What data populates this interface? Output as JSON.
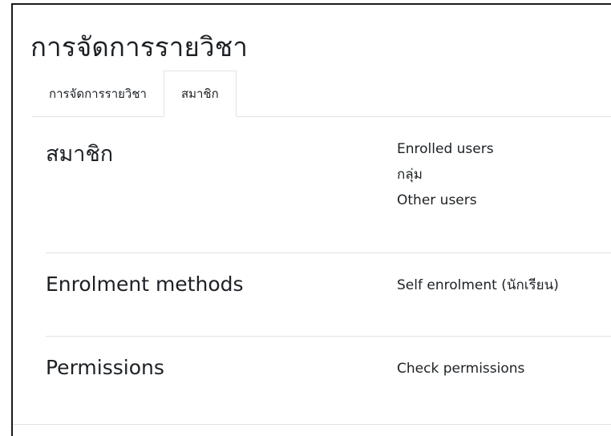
{
  "page": {
    "title": "การจัดการรายวิชา"
  },
  "tabs": [
    {
      "label": "การจัดการรายวิชา",
      "active": false
    },
    {
      "label": "สมาชิก",
      "active": true
    }
  ],
  "sections": [
    {
      "title": "สมาชิก",
      "links": [
        "Enrolled users",
        "กลุ่ม",
        "Other users"
      ]
    },
    {
      "title": "Enrolment methods",
      "links": [
        "Self enrolment (นักเรียน)"
      ]
    },
    {
      "title": "Permissions",
      "links": [
        "Check permissions"
      ]
    }
  ]
}
